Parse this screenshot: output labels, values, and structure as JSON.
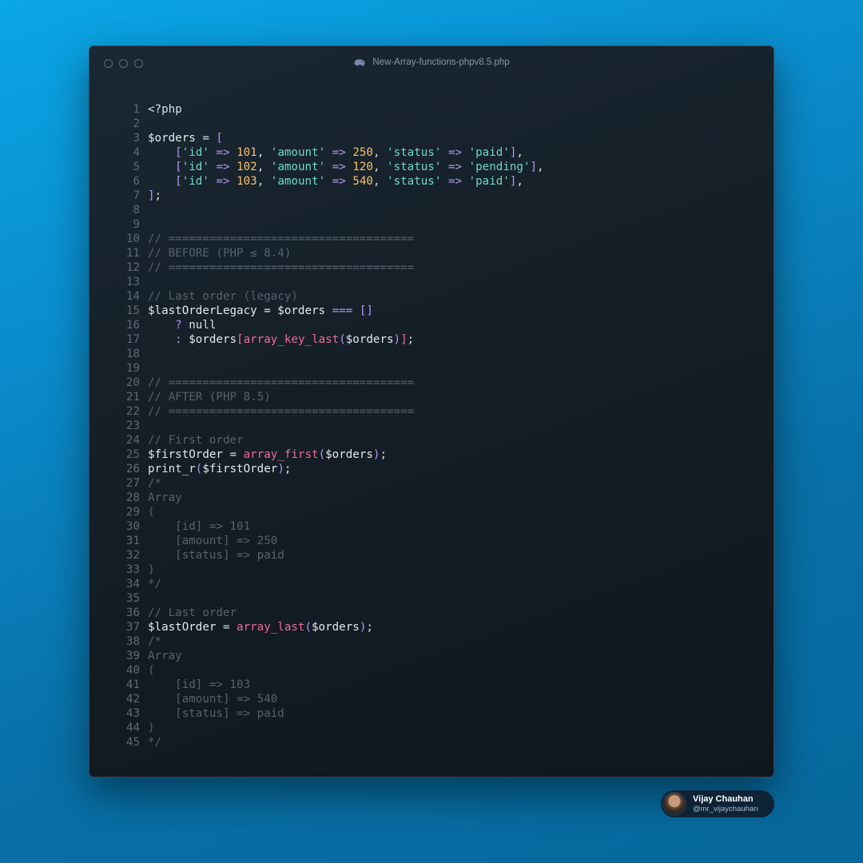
{
  "window": {
    "title": "New-Array-functions-phpv8.5.php",
    "icon": "php-elephant-icon"
  },
  "code_lines": [
    [
      [
        "p",
        "<?php"
      ]
    ],
    [],
    [
      [
        "v",
        "$orders"
      ],
      [
        "p",
        " = "
      ],
      [
        "o",
        "["
      ]
    ],
    [
      [
        "p",
        "    "
      ],
      [
        "o",
        "["
      ],
      [
        "s",
        "'id'"
      ],
      [
        "p",
        " "
      ],
      [
        "o",
        "=>"
      ],
      [
        "p",
        " "
      ],
      [
        "n",
        "101"
      ],
      [
        "p",
        ", "
      ],
      [
        "s",
        "'amount'"
      ],
      [
        "p",
        " "
      ],
      [
        "o",
        "=>"
      ],
      [
        "p",
        " "
      ],
      [
        "n",
        "250"
      ],
      [
        "p",
        ", "
      ],
      [
        "s",
        "'status'"
      ],
      [
        "p",
        " "
      ],
      [
        "o",
        "=>"
      ],
      [
        "p",
        " "
      ],
      [
        "s",
        "'paid'"
      ],
      [
        "o",
        "]"
      ],
      [
        "p",
        ","
      ]
    ],
    [
      [
        "p",
        "    "
      ],
      [
        "o",
        "["
      ],
      [
        "s",
        "'id'"
      ],
      [
        "p",
        " "
      ],
      [
        "o",
        "=>"
      ],
      [
        "p",
        " "
      ],
      [
        "n",
        "102"
      ],
      [
        "p",
        ", "
      ],
      [
        "s",
        "'amount'"
      ],
      [
        "p",
        " "
      ],
      [
        "o",
        "=>"
      ],
      [
        "p",
        " "
      ],
      [
        "n",
        "120"
      ],
      [
        "p",
        ", "
      ],
      [
        "s",
        "'status'"
      ],
      [
        "p",
        " "
      ],
      [
        "o",
        "=>"
      ],
      [
        "p",
        " "
      ],
      [
        "s",
        "'pending'"
      ],
      [
        "o",
        "]"
      ],
      [
        "p",
        ","
      ]
    ],
    [
      [
        "p",
        "    "
      ],
      [
        "o",
        "["
      ],
      [
        "s",
        "'id'"
      ],
      [
        "p",
        " "
      ],
      [
        "o",
        "=>"
      ],
      [
        "p",
        " "
      ],
      [
        "n",
        "103"
      ],
      [
        "p",
        ", "
      ],
      [
        "s",
        "'amount'"
      ],
      [
        "p",
        " "
      ],
      [
        "o",
        "=>"
      ],
      [
        "p",
        " "
      ],
      [
        "n",
        "540"
      ],
      [
        "p",
        ", "
      ],
      [
        "s",
        "'status'"
      ],
      [
        "p",
        " "
      ],
      [
        "o",
        "=>"
      ],
      [
        "p",
        " "
      ],
      [
        "s",
        "'paid'"
      ],
      [
        "o",
        "]"
      ],
      [
        "p",
        ","
      ]
    ],
    [
      [
        "o",
        "]"
      ],
      [
        "p",
        ";"
      ]
    ],
    [],
    [],
    [
      [
        "c",
        "// ===================================="
      ]
    ],
    [
      [
        "c",
        "// BEFORE (PHP ≤ 8.4)"
      ]
    ],
    [
      [
        "c",
        "// ===================================="
      ]
    ],
    [],
    [
      [
        "c",
        "// Last order (legacy)"
      ]
    ],
    [
      [
        "v",
        "$lastOrderLegacy"
      ],
      [
        "p",
        " = "
      ],
      [
        "v",
        "$orders"
      ],
      [
        "p",
        " "
      ],
      [
        "o",
        "==="
      ],
      [
        "p",
        " "
      ],
      [
        "o",
        "[]"
      ]
    ],
    [
      [
        "p",
        "    "
      ],
      [
        "o",
        "?"
      ],
      [
        "p",
        " null"
      ]
    ],
    [
      [
        "p",
        "    "
      ],
      [
        "o",
        ":"
      ],
      [
        "p",
        " "
      ],
      [
        "v",
        "$orders"
      ],
      [
        "f",
        "["
      ],
      [
        "f",
        "array_key_last"
      ],
      [
        "o",
        "("
      ],
      [
        "v",
        "$orders"
      ],
      [
        "o",
        ")"
      ],
      [
        "f",
        "]"
      ],
      [
        "p",
        ";"
      ]
    ],
    [],
    [],
    [
      [
        "c",
        "// ===================================="
      ]
    ],
    [
      [
        "c",
        "// AFTER (PHP 8.5)"
      ]
    ],
    [
      [
        "c",
        "// ===================================="
      ]
    ],
    [],
    [
      [
        "c",
        "// First order"
      ]
    ],
    [
      [
        "v",
        "$firstOrder"
      ],
      [
        "p",
        " = "
      ],
      [
        "f",
        "array_first"
      ],
      [
        "o",
        "("
      ],
      [
        "v",
        "$orders"
      ],
      [
        "o",
        ")"
      ],
      [
        "p",
        ";"
      ]
    ],
    [
      [
        "p",
        "print_r"
      ],
      [
        "o",
        "("
      ],
      [
        "v",
        "$firstOrder"
      ],
      [
        "o",
        ")"
      ],
      [
        "p",
        ";"
      ]
    ],
    [
      [
        "c",
        "/*"
      ]
    ],
    [
      [
        "c",
        "Array"
      ]
    ],
    [
      [
        "c",
        "("
      ]
    ],
    [
      [
        "c",
        "    [id] => 101"
      ]
    ],
    [
      [
        "c",
        "    [amount] => 250"
      ]
    ],
    [
      [
        "c",
        "    [status] => paid"
      ]
    ],
    [
      [
        "c",
        ")"
      ]
    ],
    [
      [
        "c",
        "*/"
      ]
    ],
    [],
    [
      [
        "c",
        "// Last order"
      ]
    ],
    [
      [
        "v",
        "$lastOrder"
      ],
      [
        "p",
        " = "
      ],
      [
        "f",
        "array_last"
      ],
      [
        "o",
        "("
      ],
      [
        "v",
        "$orders"
      ],
      [
        "o",
        ")"
      ],
      [
        "p",
        ";"
      ]
    ],
    [
      [
        "c",
        "/*"
      ]
    ],
    [
      [
        "c",
        "Array"
      ]
    ],
    [
      [
        "c",
        "("
      ]
    ],
    [
      [
        "c",
        "    [id] => 103"
      ]
    ],
    [
      [
        "c",
        "    [amount] => 540"
      ]
    ],
    [
      [
        "c",
        "    [status] => paid"
      ]
    ],
    [
      [
        "c",
        ")"
      ]
    ],
    [
      [
        "c",
        "*/"
      ]
    ]
  ],
  "author": {
    "name": "Vijay Chauhan",
    "handle": "@mr_vijaychauhan",
    "avatar_icon": "avatar-photo"
  }
}
